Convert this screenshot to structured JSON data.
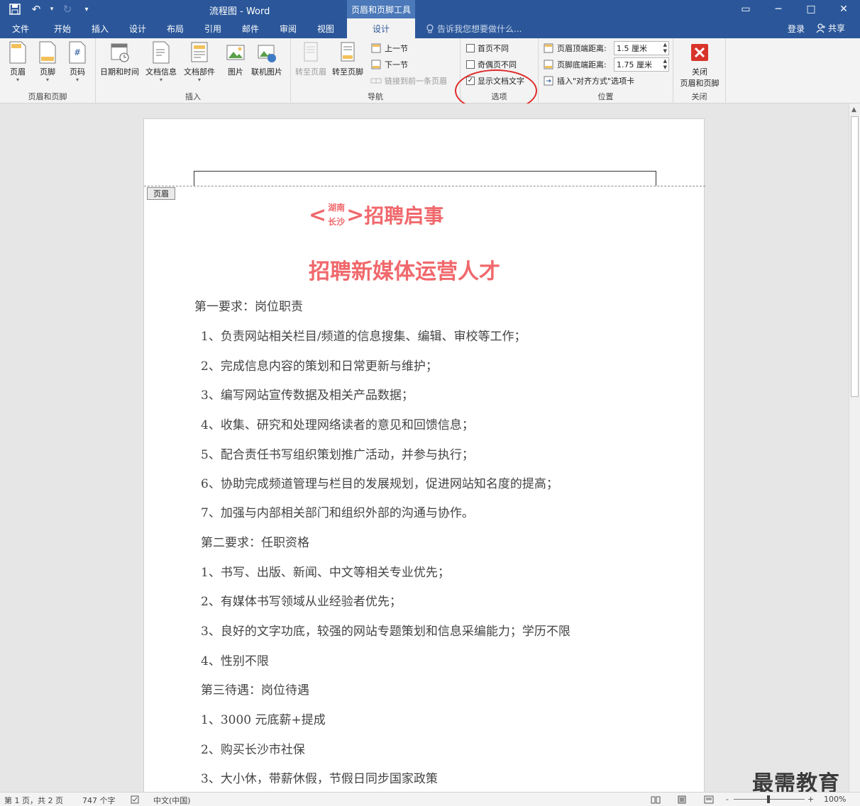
{
  "titlebar": {
    "title": "流程图 - Word",
    "context_tab": "页眉和页脚工具",
    "qat": {
      "save": "💾",
      "undo": "↶",
      "undo_drop": "▾",
      "redo": "↻",
      "customize": "▾"
    },
    "controls": {
      "ribbon_options": "▭",
      "minimize": "─",
      "maximize": "□",
      "close": "✕"
    }
  },
  "tabs": [
    {
      "label": "文件"
    },
    {
      "label": "开始"
    },
    {
      "label": "插入"
    },
    {
      "label": "设计"
    },
    {
      "label": "布局"
    },
    {
      "label": "引用"
    },
    {
      "label": "邮件"
    },
    {
      "label": "审阅"
    },
    {
      "label": "视图"
    },
    {
      "label": "设计"
    }
  ],
  "tellme": {
    "text": "告诉我您想要做什么..."
  },
  "account": {
    "signin": "登录",
    "share": "共享"
  },
  "ribbon": {
    "groups": {
      "header_footer": {
        "label": "页眉和页脚",
        "header": "页眉",
        "footer": "页脚",
        "page_number": "页码"
      },
      "insert": {
        "label": "插入",
        "date_time": "日期和时间",
        "doc_info": "文档信息",
        "doc_parts": "文档部件",
        "picture": "图片",
        "online_picture": "联机图片"
      },
      "navigation": {
        "label": "导航",
        "goto_header": "转至页眉",
        "goto_footer": "转至页脚",
        "prev_section": "上一节",
        "next_section": "下一节",
        "link_prev": "链接到前一条页眉"
      },
      "options": {
        "label": "选项",
        "first_page_different": "首页不同",
        "odd_even_different": "奇偶页不同",
        "show_doc_text": "显示文档文字",
        "show_doc_text_check": "✓"
      },
      "position": {
        "label": "位置",
        "header_top_label": "页眉顶端距离:",
        "header_top_value": "1.5 厘米",
        "footer_bottom_label": "页脚底端距离:",
        "footer_bottom_value": "1.75 厘米",
        "insert_align_tab": "插入\"对齐方式\"选项卡"
      },
      "close": {
        "label": "关闭",
        "close_line1": "关闭",
        "close_line2": "页眉和页脚"
      }
    }
  },
  "document": {
    "header_tag": "页眉",
    "title": {
      "left": "<",
      "top": "湖南",
      "bottom": "长沙",
      "right": ">",
      "main": "招聘启事"
    },
    "subtitle": "招聘新媒体运营人才",
    "lines": [
      "第一要求：岗位职责",
      "1、负责网站相关栏目/频道的信息搜集、编辑、审校等工作；",
      "2、完成信息内容的策划和日常更新与维护；",
      "3、编写网站宣传数据及相关产品数据；",
      "4、收集、研究和处理网络读者的意见和回馈信息；",
      "5、配合责任书写组织策划推广活动，并参与执行；",
      "6、协助完成频道管理与栏目的发展规划，促进网站知名度的提高；",
      "7、加强与内部相关部门和组织外部的沟通与协作。",
      "第二要求：任职资格",
      "1、书写、出版、新闻、中文等相关专业优先；",
      "2、有媒体书写领域从业经验者优先；",
      "3、良好的文字功底，较强的网站专题策划和信息采编能力；学历不限",
      "4、性别不限",
      "第三待遇：岗位待遇",
      "1、3000 元底薪+提成",
      "2、购买长沙市社保",
      "3、大小休，带薪休假，节假日同步国家政策"
    ]
  },
  "watermark": "最需教育",
  "statusbar": {
    "page": "第 1 页，共 2 页",
    "words": "747 个字",
    "lang": "中文(中国)",
    "zoom_minus": "-",
    "zoom_plus": "+",
    "zoom": "100%"
  },
  "colors": {
    "accent": "#2b579a",
    "title_red": "#f0686c",
    "annotation": "#e02a2a"
  }
}
